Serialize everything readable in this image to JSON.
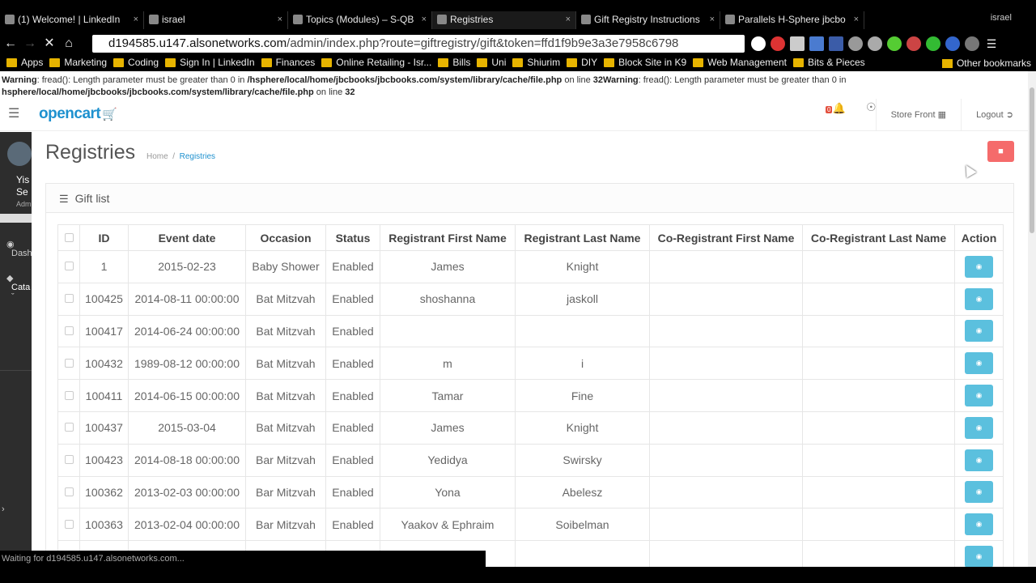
{
  "browser": {
    "tabs": [
      {
        "label": "(1) Welcome! | LinkedIn",
        "icon": "linkedin-icon"
      },
      {
        "label": "israel",
        "icon": "green-shield-icon"
      },
      {
        "label": "Topics (Modules) – S-QB",
        "icon": "bb-icon"
      },
      {
        "label": "Registries",
        "icon": "opencart-icon"
      },
      {
        "label": "Gift Registry Instructions",
        "icon": "doc-icon"
      },
      {
        "label": "Parallels H-Sphere jbcbo",
        "icon": "doc-icon"
      }
    ],
    "profile": "israel",
    "url_host": "d194585.u147.alsonetworks.com",
    "url_path": "/admin/index.php?route=giftregistry/gift&token=ffd1f9b9e3a3e7958c6798",
    "bookmarks": [
      "Apps",
      "Marketing",
      "Coding",
      "Sign In | LinkedIn",
      "Finances",
      "Online Retailing - Isr...",
      "Bills",
      "Uni",
      "Shiurim",
      "DIY",
      "Block Site in K9",
      "Web Management",
      "Bits & Pieces"
    ],
    "other_bookmarks": "Other bookmarks",
    "status_text": "Waiting for d194585.u147.alsonetworks.com..."
  },
  "warning": {
    "label1": "Warning",
    "msg1": ": fread(): Length parameter must be greater than 0 in ",
    "path1": "/hsphere/local/home/jbcbooks/jbcbooks.com/system/library/cache/file.php",
    "online1": " on line ",
    "line1": "32",
    "label2": "Warning",
    "msg2": ": fread(): Length parameter must be greater than 0 in",
    "path2": "hsphere/local/home/jbcbooks/jbcbooks.com/system/library/cache/file.php",
    "online2": " on line ",
    "line2": "32"
  },
  "header": {
    "logo": "opencart",
    "store_front": "Store Front",
    "logout": "Logout",
    "alert_count": "0"
  },
  "sidebar": {
    "user_name_1": "Yis",
    "user_name_2": "Se",
    "user_role": "Adm",
    "item_dashboard": "Dash",
    "item_catalog": "Cata"
  },
  "page": {
    "title": "Registries",
    "breadcrumb_home": "Home",
    "breadcrumb_current": "Registries",
    "panel_title": "Gift list"
  },
  "table": {
    "headers": [
      "ID",
      "Event date",
      "Occasion",
      "Status",
      "Registrant First Name",
      "Registrant Last Name",
      "Co-Registrant First Name",
      "Co-Registrant Last Name",
      "Action"
    ],
    "rows": [
      [
        "1",
        "2015-02-23",
        "Baby Shower",
        "Enabled",
        "James",
        "Knight",
        "",
        ""
      ],
      [
        "100425",
        "2014-08-11 00:00:00",
        "Bat Mitzvah",
        "Enabled",
        "shoshanna",
        "jaskoll",
        "",
        ""
      ],
      [
        "100417",
        "2014-06-24 00:00:00",
        "Bat Mitzvah",
        "Enabled",
        "",
        "",
        "",
        ""
      ],
      [
        "100432",
        "1989-08-12 00:00:00",
        "Bat Mitzvah",
        "Enabled",
        "m",
        "i",
        "",
        ""
      ],
      [
        "100411",
        "2014-06-15 00:00:00",
        "Bat Mitzvah",
        "Enabled",
        "Tamar",
        "Fine",
        "",
        ""
      ],
      [
        "100437",
        "2015-03-04",
        "Bat Mitzvah",
        "Enabled",
        "James",
        "Knight",
        "",
        ""
      ],
      [
        "100423",
        "2014-08-18 00:00:00",
        "Bar Mitzvah",
        "Enabled",
        "Yedidya",
        "Swirsky",
        "",
        ""
      ],
      [
        "100362",
        "2013-02-03 00:00:00",
        "Bar Mitzvah",
        "Enabled",
        "Yona",
        "Abelesz",
        "",
        ""
      ],
      [
        "100363",
        "2013-02-04 00:00:00",
        "Bar Mitzvah",
        "Enabled",
        "Yaakov & Ephraim",
        "Soibelman",
        "",
        ""
      ],
      [
        "",
        "",
        "",
        "",
        "",
        "",
        "",
        ""
      ]
    ]
  },
  "colors": {
    "accent": "#1e91cf",
    "view_button": "#5bc0de",
    "delete_button": "#f56b6b"
  }
}
